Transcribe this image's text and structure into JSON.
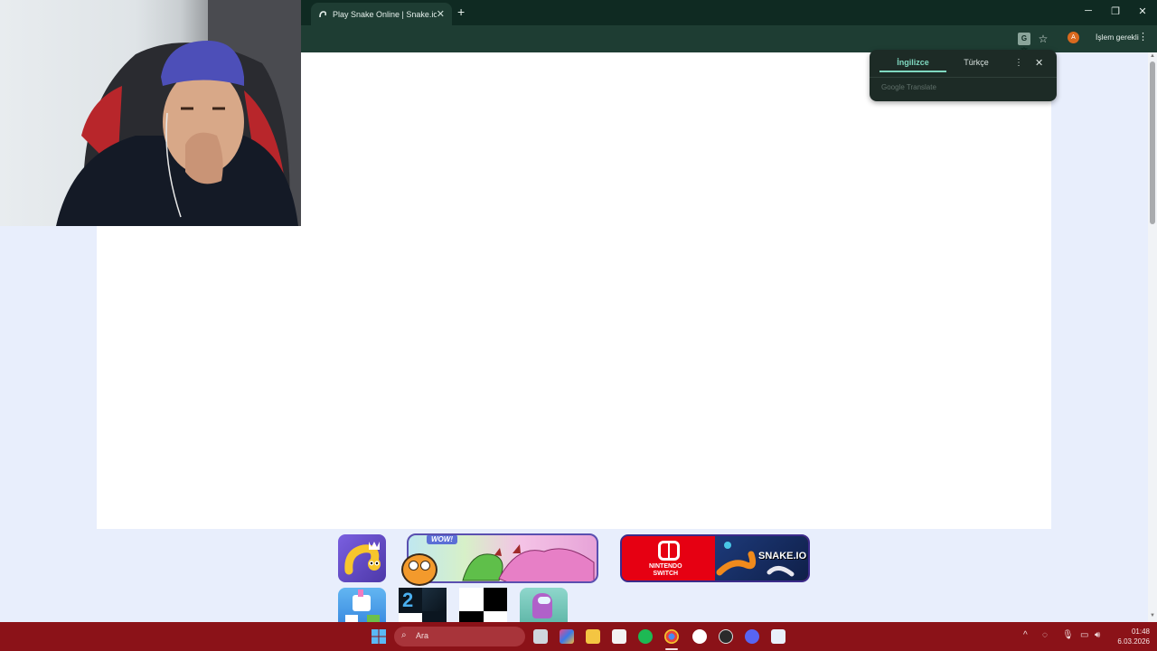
{
  "browser": {
    "tab_title": "Play Snake Online | Snake.io",
    "new_tab_label": "+",
    "tab_close_label": "✕",
    "minimize_label": "─",
    "restore_label": "❐",
    "close_label": "✕",
    "action_required_label": "İşlem gerekli",
    "profile_initial": "A",
    "translate_icon_label": "G文",
    "more_label": "⋮",
    "star_label": "☆"
  },
  "translate_popup": {
    "source_language": "İngilizce",
    "target_language": "Türkçe",
    "more_label": "⋮",
    "close_label": "✕",
    "powered_by": "Google Translate"
  },
  "game_tiles": [
    {
      "name": "Snake.io icon",
      "color": "#6b4fc8"
    },
    {
      "name": "Dragon promo",
      "badge": "WOW!",
      "color": "#3fa0c8"
    },
    {
      "name": "Nintendo Switch Snake.io",
      "text_left": "NINTENDO\nSWITCH",
      "text_right": "SNAKE.IO",
      "color": "#e60012"
    },
    {
      "name": "Unicorn game",
      "color": "#4ba3e8"
    },
    {
      "name": "Piano tiles 2",
      "badge": "2",
      "color": "#0b1620"
    },
    {
      "name": "Checker tiles",
      "color": "#000000"
    },
    {
      "name": "Among-style game",
      "color": "#7ed0c4"
    }
  ],
  "taskbar": {
    "search_placeholder": "Ara",
    "search_icon": "search-icon",
    "time": "01:48",
    "date": "6.03.2026",
    "chevron": "^",
    "accent_color": "#8b1218"
  }
}
